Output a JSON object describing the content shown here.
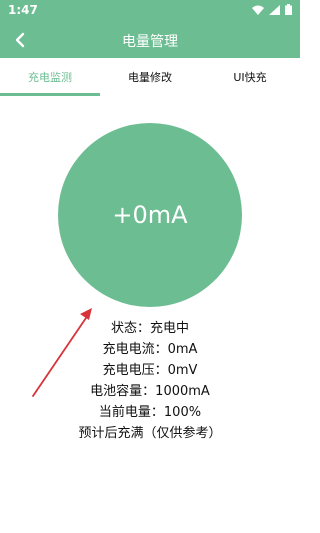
{
  "status_bar": {
    "time": "1:47",
    "icons": [
      "wifi-icon",
      "signal-icon",
      "battery-icon"
    ]
  },
  "app_bar": {
    "title": "电量管理",
    "back_icon": "back-chevron-icon"
  },
  "tabs": [
    {
      "label": "充电监测",
      "active": true
    },
    {
      "label": "电量修改",
      "active": false
    },
    {
      "label": "UI快充",
      "active": false
    }
  ],
  "current_display": "+0mA",
  "info_lines": [
    "状态：充电中",
    "充电电流：0mA",
    "充电电压：0mV",
    "电池容量：1000mA",
    "当前电量：100%",
    "预计后充满（仅供参考）"
  ],
  "colors": {
    "accent": "#6dbd93",
    "arrow": "#d9333a"
  }
}
